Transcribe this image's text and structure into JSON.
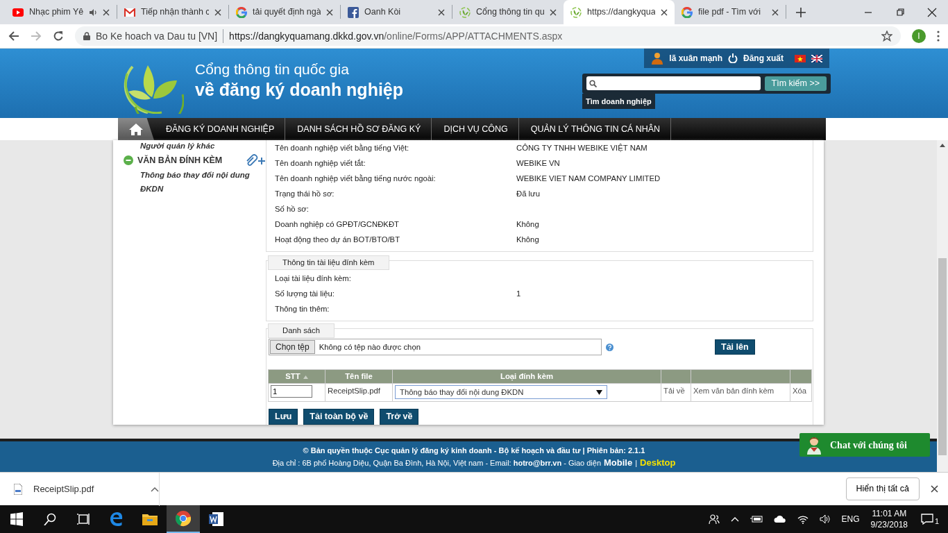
{
  "browser": {
    "tabs": [
      {
        "title": "Nhạc phim Yê",
        "kind": "youtube",
        "audio": true,
        "selected": false
      },
      {
        "title": "Tiếp nhận thành c",
        "kind": "gmail",
        "audio": false,
        "selected": false
      },
      {
        "title": "tải quyết định ngà",
        "kind": "google",
        "audio": false,
        "selected": false
      },
      {
        "title": "Oanh Kòi",
        "kind": "facebook",
        "audio": false,
        "selected": false
      },
      {
        "title": "Cổng thông tin qu",
        "kind": "portal",
        "audio": false,
        "selected": false
      },
      {
        "title": "https://dangkyqua",
        "kind": "portal",
        "audio": false,
        "selected": true
      },
      {
        "title": "file pdf - Tìm với",
        "kind": "google",
        "audio": false,
        "selected": false
      }
    ],
    "site_name": "Bo Ke hoach va Dau tu [VN]",
    "url_host": "https://dangkyquamang.dkkd.gov.vn",
    "url_path": "/online/Forms/APP/ATTACHMENTS.aspx",
    "profile_initial": "I"
  },
  "header": {
    "title_line1": "Cổng thông tin quốc gia",
    "title_line2": "về đăng ký doanh nghiệp",
    "user_name": "lã xuân mạnh",
    "logout": "Đăng xuất",
    "search_button": "Tìm kiếm >>",
    "search_hint": "Tìm doanh nghiệp"
  },
  "nav": [
    {
      "kind": "home"
    },
    {
      "kind": "link",
      "label": "ĐĂNG KÝ DOANH NGHIỆP"
    },
    {
      "kind": "link",
      "label": "DANH SÁCH HỒ SƠ ĐĂNG KÝ"
    },
    {
      "kind": "link",
      "label": "DỊCH VỤ CÔNG"
    },
    {
      "kind": "link",
      "label": "QUẢN LÝ THÔNG TIN CÁ NHÂN"
    }
  ],
  "sidebar": {
    "items": [
      {
        "kind": "link",
        "label": "Người quản lý khác"
      },
      {
        "kind": "section",
        "label": "VĂN BẢN ĐÍNH KÈM",
        "expanded": true
      },
      {
        "kind": "link",
        "label": "Thông báo thay đổi nội dung ĐKDN"
      }
    ]
  },
  "company_info": {
    "rows": [
      {
        "label": "Tên doanh nghiệp viết bằng tiếng Việt:",
        "value": "CÔNG TY TNHH WEBIKE VIỆT NAM"
      },
      {
        "label": "Tên doanh nghiệp viết tắt:",
        "value": "WEBIKE VN"
      },
      {
        "label": "Tên doanh nghiệp viết bằng tiếng nước ngoài:",
        "value": "WEBIKE VIET NAM COMPANY LIMITED"
      },
      {
        "label": "Trạng thái hồ sơ:",
        "value": "Đã lưu"
      },
      {
        "label": "Số hồ sơ:"
      },
      {
        "label": "Doanh nghiệp có GPĐT/GCNĐKĐT",
        "value": "Không"
      },
      {
        "label": "Hoạt động theo dự án BOT/BTO/BT",
        "value": "Không"
      }
    ]
  },
  "attachment_info": {
    "legend": "Thông tin tài liệu đính kèm",
    "rows": [
      {
        "label": "Loại tài liệu đính kèm:"
      },
      {
        "label": "Số lượng tài liệu:",
        "value": "1"
      },
      {
        "label": "Thông tin thêm:"
      }
    ]
  },
  "list": {
    "legend": "Danh sách",
    "file_button": "Chọn tệp",
    "file_status": "Không có tệp nào được chọn",
    "upload_button": "Tải lên",
    "table": {
      "columns": [
        "STT",
        "Tên file",
        "Loại đính kèm"
      ],
      "rows": [
        {
          "stt": "1",
          "file": "ReceiptSlip.pdf",
          "type": "Thông báo thay đổi nội dung ĐKDN",
          "download": "Tải về",
          "view": "Xem văn bản đính kèm",
          "delete": "Xóa"
        }
      ]
    },
    "buttons": [
      "Lưu",
      "Tải toàn bộ về",
      "Trở về"
    ]
  },
  "footer": {
    "line1": "© Bản quyền thuộc Cục quản lý đăng ký kinh doanh - Bộ kế hoạch và đầu tư | Phiên bản: 2.1.1",
    "line2": "Địa chỉ : 6B phố Hoàng Diệu, Quận Ba Đình, Hà Nội, Việt nam - Email: **hotro@brr.vn** - Giao diện",
    "mobile": "Mobile",
    "separator": "|",
    "desktop": "Desktop"
  },
  "chat": "Chat với chúng tôi",
  "downloads": {
    "file": "ReceiptSlip.pdf",
    "show_all": "Hiển thị tất cả"
  },
  "taskbar": {
    "apps": [
      {
        "kind": "edge",
        "selected": false
      },
      {
        "kind": "explorer",
        "selected": false
      },
      {
        "kind": "chrome",
        "selected": true
      },
      {
        "kind": "word",
        "selected": false
      }
    ],
    "language": "ENG",
    "time": "11:01 AM",
    "date": "9/23/2018",
    "notifications": "1"
  }
}
